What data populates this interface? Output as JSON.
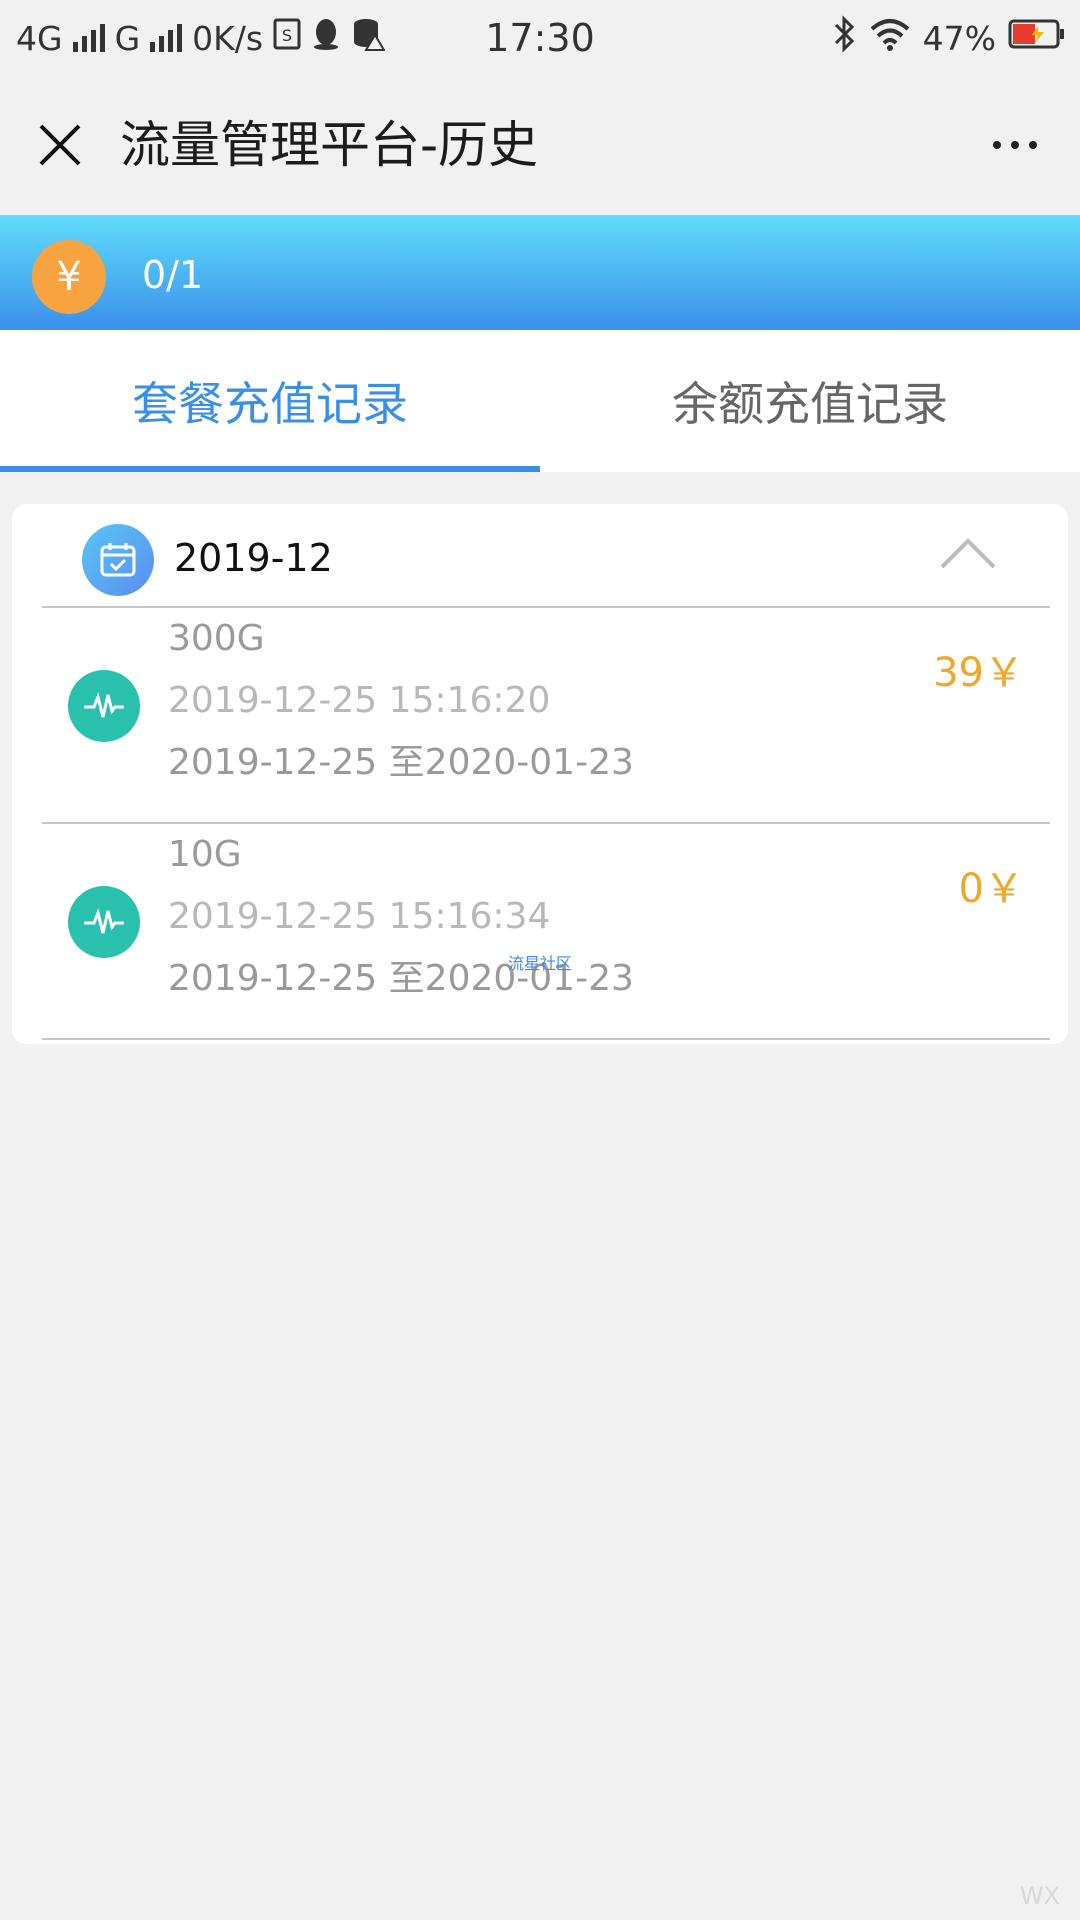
{
  "status_bar": {
    "network1": "4G",
    "network2": "G",
    "speed": "0K/s",
    "time": "17:30",
    "battery": "47%"
  },
  "titlebar": {
    "title": "流量管理平台-历史"
  },
  "banner": {
    "coin_symbol": "¥",
    "balance": "0/1"
  },
  "tabs": [
    {
      "label": "套餐充值记录",
      "active": true
    },
    {
      "label": "余额充值记录",
      "active": false
    }
  ],
  "month_group": {
    "month": "2019-12",
    "records": [
      {
        "name": "300G",
        "time": "2019-12-25 15:16:20",
        "range": "2019-12-25 至2020-01-23",
        "price": "39￥"
      },
      {
        "name": "10G",
        "time": "2019-12-25 15:16:34",
        "range": "2019-12-25 至2020-01-23",
        "price": "0￥"
      }
    ]
  },
  "watermarks": {
    "middle": "流星社区",
    "corner": "WX"
  },
  "colors": {
    "accent": "#3b8be8",
    "price": "#f0a72a",
    "coin": "#f7a340",
    "record_icon": "#29c1ad"
  }
}
